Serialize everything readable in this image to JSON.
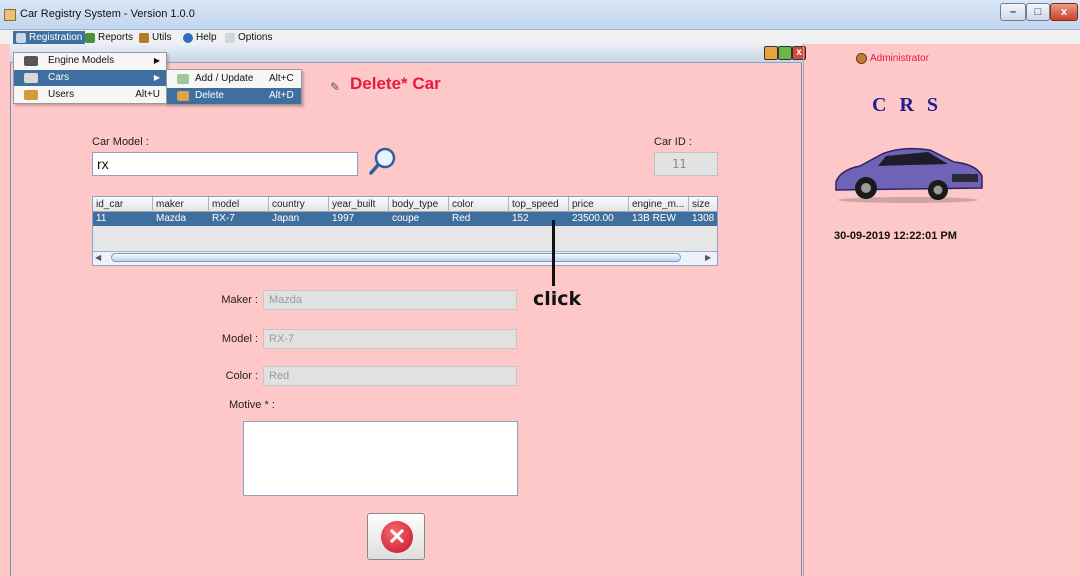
{
  "window": {
    "title": "Car Registry System  -  Version 1.0.0",
    "min_glyph": "–",
    "max_glyph": "□",
    "close_glyph": "x"
  },
  "menubar": [
    {
      "label": "Registration",
      "icon": "registration-icon"
    },
    {
      "label": "Reports",
      "icon": "reports-icon"
    },
    {
      "label": "Utils",
      "icon": "utils-icon"
    },
    {
      "label": "Help",
      "icon": "help-icon"
    },
    {
      "label": "Options",
      "icon": "options-icon"
    }
  ],
  "registration_menu": [
    {
      "label": "Engine Models",
      "submenu": true
    },
    {
      "label": "Cars",
      "submenu": true
    },
    {
      "label": "Users",
      "shortcut": "Alt+U"
    }
  ],
  "cars_submenu": [
    {
      "label": "Add / Update",
      "shortcut": "Alt+C"
    },
    {
      "label": "Delete",
      "shortcut": "Alt+D"
    }
  ],
  "form": {
    "title": "Delete* Car",
    "car_model_label": "Car Model :",
    "car_model_value": "rx",
    "car_id_label": "Car ID :",
    "car_id_value": "11",
    "maker_label": "Maker :",
    "maker_value": "Mazda",
    "model_label": "Model :",
    "model_value": "RX-7",
    "color_label": "Color :",
    "color_value": "Red",
    "motive_label": "Motive * :",
    "motive_value": "",
    "delete_glyph": "✕"
  },
  "table": {
    "columns": [
      "id_car",
      "maker",
      "model",
      "country",
      "year_built",
      "body_type",
      "color",
      "top_speed",
      "price",
      "engine_m...",
      "size"
    ],
    "rows": [
      [
        "11",
        "Mazda",
        "RX-7",
        "Japan",
        "1997",
        "coupe",
        "Red",
        "152",
        "23500.00",
        "13B REW",
        "1308"
      ]
    ]
  },
  "annotation": {
    "label": "click"
  },
  "sidebar": {
    "user": "Administrator",
    "logo": "C R S",
    "datetime": "30-09-2019 12:22:01 PM"
  },
  "colors": {
    "accent": "#e8193f",
    "selection": "#3f6f9f",
    "background": "#ffc8c8",
    "logo": "#201d8c"
  }
}
